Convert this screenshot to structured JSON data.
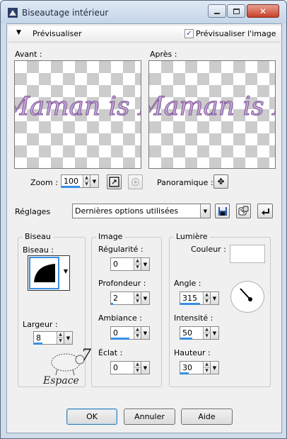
{
  "window": {
    "title": "Biseautage intérieur",
    "icons": [
      "app-icon",
      "minimize-icon",
      "maximize-icon",
      "close-icon"
    ]
  },
  "header": {
    "preview_label": "Prévisualiser",
    "preview_image_label": "Prévisualiser l'image",
    "preview_image_checked": true
  },
  "previews": {
    "before_label": "Avant :",
    "after_label": "Après :",
    "sample_text": "Maman is L"
  },
  "zoom": {
    "label": "Zoom :",
    "value": "100",
    "pan_label": "Panoramique :"
  },
  "settings": {
    "label": "Réglages",
    "value": "Dernières options utilisées"
  },
  "bevel": {
    "group": "Biseau",
    "bevel_label": "Biseau :",
    "width_label": "Largeur :",
    "width_value": "8"
  },
  "image": {
    "group": "Image",
    "smoothness_label": "Régularité :",
    "smoothness_value": "0",
    "depth_label": "Profondeur :",
    "depth_value": "2",
    "ambience_label": "Ambiance :",
    "ambience_value": "0",
    "shininess_label": "Éclat :",
    "shininess_value": "0"
  },
  "light": {
    "group": "Lumière",
    "color_label": "Couleur :",
    "color_value": "#ffffff",
    "angle_label": "Angle :",
    "angle_value": "315",
    "intensity_label": "Intensité :",
    "intensity_value": "50",
    "elevation_label": "Hauteur :",
    "elevation_value": "30"
  },
  "watermark": {
    "text": "Espace",
    "number": "7"
  },
  "buttons": {
    "ok": "OK",
    "cancel": "Annuler",
    "help": "Aide"
  }
}
